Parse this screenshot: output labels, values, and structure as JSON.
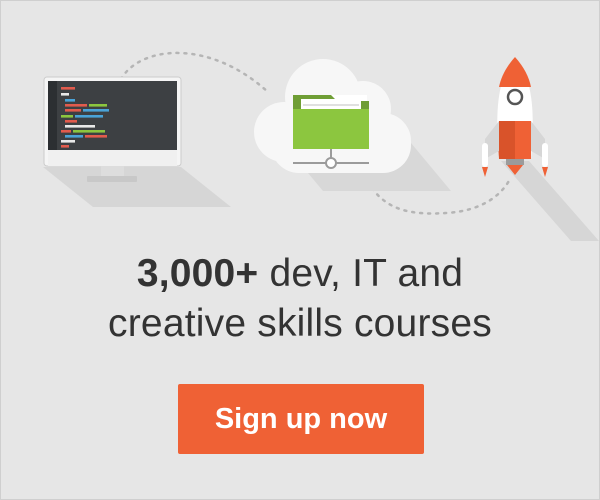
{
  "headline": {
    "highlight": "3,000+",
    "line1_rest": " dev, IT and",
    "line2": "creative skills courses"
  },
  "cta": {
    "label": "Sign up now"
  },
  "icons": {
    "monitor": "code-monitor-icon",
    "cloud": "cloud-folder-icon",
    "rocket": "rocket-icon"
  },
  "colors": {
    "background": "#e6e6e6",
    "accent": "#ef6135",
    "text": "#333333",
    "folder": "#8cc63f"
  }
}
